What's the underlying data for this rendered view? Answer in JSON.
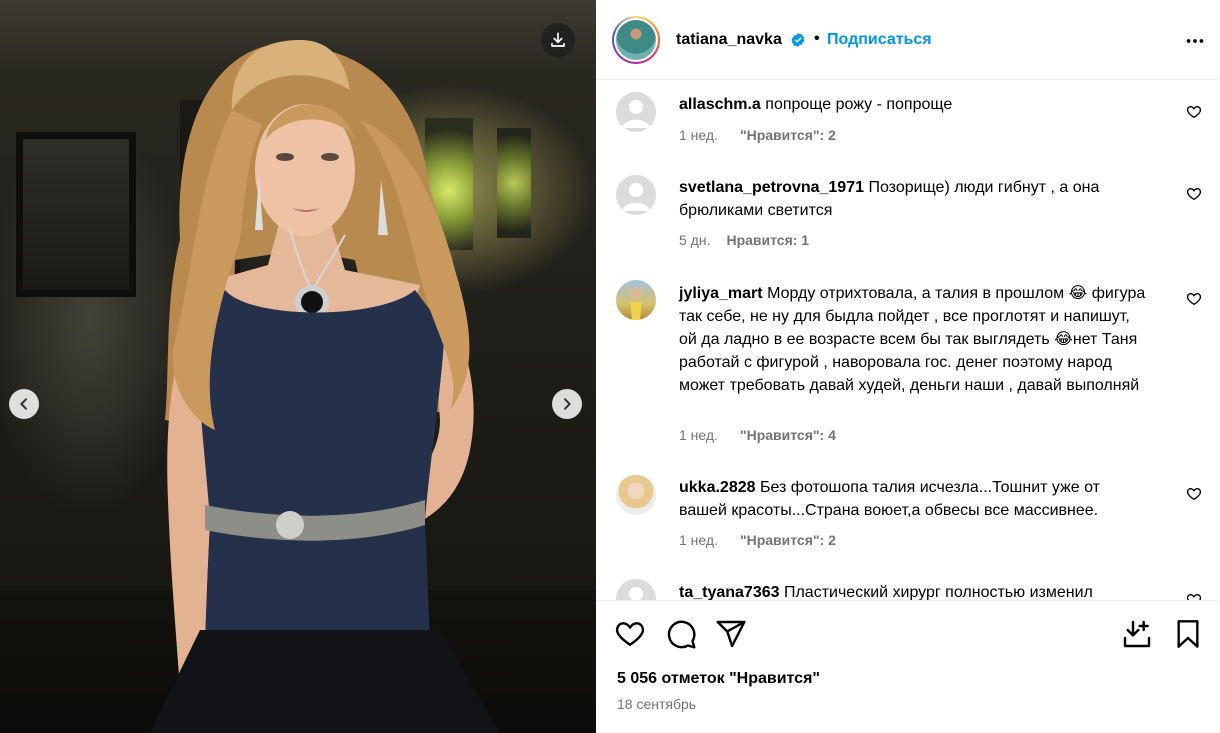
{
  "post": {
    "username": "tatiana_navka",
    "separator": "•",
    "follow_label": "Подписаться",
    "likes_text": "5 056 отметок \"Нравится\"",
    "date": "18 сентябрь"
  },
  "comments": [
    {
      "username": "allaschm.a",
      "text": "попроще рожу - попроще",
      "time": "1 нед.",
      "likes": "\"Нравится\": 2",
      "avatar": "default-avatar"
    },
    {
      "username": "svetlana_petrovna_1971",
      "text": "Позорище) люди гибнут , а она брюликами светится",
      "time": "5 дн.",
      "likes": "Нравится: 1",
      "avatar": "default-avatar"
    },
    {
      "username": "jyliya_mart",
      "text": "Морду отрихтовала, а талия в прошлом 😂 фигура так себе, не ну для быдла пойдет , все проглотят и напишут, ой да ладно в ее возрасте всем бы так выглядеть 😂нет Таня работай с фигурой , наворовала гос. денег поэтому народ может требовать давай худей, деньги наши , давай выполняй",
      "time": "1 нед.",
      "likes": "\"Нравится\": 4",
      "avatar": "photo-avatar"
    },
    {
      "username": "ukka.2828",
      "text": "Без фотошопа талия исчезла...Тошнит уже от вашей красоты...Страна воюет,а обвесы все массивнее.",
      "time": "1 нед.",
      "likes": "\"Нравится\": 2",
      "avatar": "photo-avatar"
    },
    {
      "username": "ta_tyana7363",
      "text": "Пластический хирург полностью изменил",
      "time": "",
      "likes": "",
      "avatar": "default-avatar"
    }
  ],
  "icons": {
    "download": "download-icon",
    "prev": "chevron-left-icon",
    "next": "chevron-right-icon",
    "more": "more-horizontal-icon",
    "verified": "verified-badge-icon",
    "like": "heart-icon",
    "comment": "comment-icon",
    "share": "share-icon",
    "save": "bookmark-icon",
    "save_download": "save-download-icon"
  },
  "colors": {
    "link_blue": "#0095f6",
    "muted_text": "#737373",
    "verified_blue": "#0095f6"
  }
}
